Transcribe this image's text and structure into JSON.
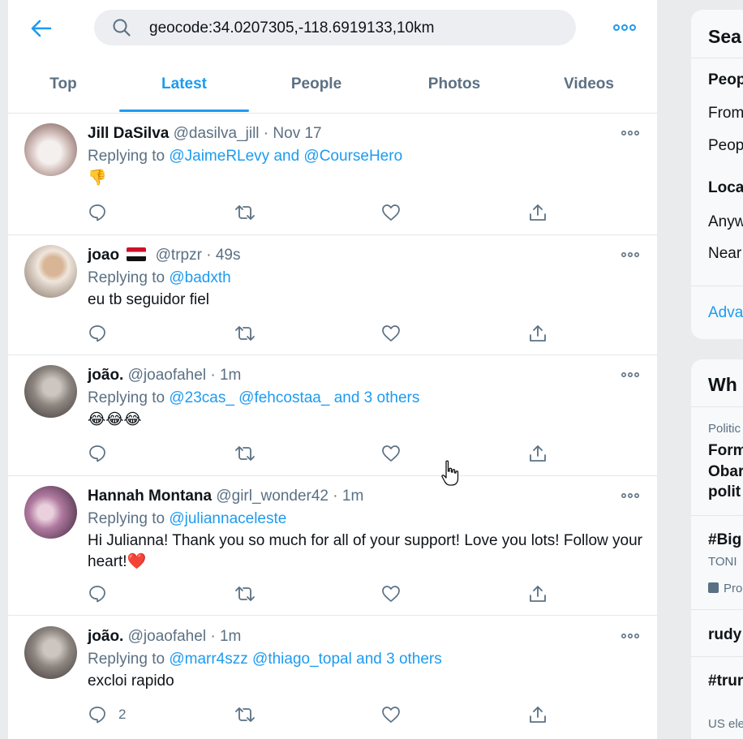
{
  "search": {
    "query": "geocode:34.0207305,-118.6919133,10km"
  },
  "tabs": {
    "top": "Top",
    "latest": "Latest",
    "people": "People",
    "photos": "Photos",
    "videos": "Videos",
    "active": "Latest"
  },
  "tweets": [
    {
      "name": "Jill DaSilva",
      "handle": "@dasilva_jill",
      "time": "Nov 17",
      "reply_prefix": "Replying to",
      "mentions": "@JaimeRLevy and @CourseHero",
      "body": "👎",
      "reply_count": ""
    },
    {
      "name": "joao",
      "handle": "@trpzr",
      "time": "49s",
      "reply_prefix": "Replying to",
      "mentions": "@badxth",
      "body": "eu tb seguidor fiel",
      "reply_count": ""
    },
    {
      "name": "joão.",
      "handle": "@joaofahel",
      "time": "1m",
      "reply_prefix": "Replying to",
      "mentions": "@23cas_ @fehcostaa_ and 3 others",
      "body": "😂😂😂",
      "reply_count": ""
    },
    {
      "name": "Hannah Montana",
      "handle": "@girl_wonder42",
      "time": "1m",
      "reply_prefix": "Replying to",
      "mentions": "@juliannaceleste",
      "body": "Hi Julianna! Thank you so much for all of your support! Love you lots! Follow your heart!❤️",
      "reply_count": ""
    },
    {
      "name": "joão.",
      "handle": "@joaofahel",
      "time": "1m",
      "reply_prefix": "Replying to",
      "mentions": "@marr4szz @thiago_topal and 3 others",
      "body": "excloi rapido",
      "reply_count": "2"
    }
  ],
  "sidebar": {
    "search_heading": "Sea",
    "people_heading": "Peop",
    "from_option": "From",
    "people_option": "Peop",
    "location_heading": "Loca",
    "anywhere_option": "Anyw",
    "near_option": "Near",
    "advanced_link": "Adva",
    "trends_heading": "Wh",
    "trend1_category": "Politic",
    "trend1_lines": [
      "Form",
      "Obar",
      "polit"
    ],
    "trend2_tag": "#Big",
    "trend2_sub": "TONI",
    "trend2_promo": "Pro",
    "trend3_tag": "rudy",
    "trend4_tag": "#trur",
    "trend4_sub": "US ele"
  },
  "colors": {
    "accent": "#1d9bf0",
    "secondary_text": "#5b7083",
    "primary_text": "#0f1419",
    "heart": "#e0245e"
  },
  "icons": {
    "back": "arrow-left-icon",
    "search": "magnifier-icon",
    "more": "more-dots-icon",
    "reply": "reply-icon",
    "retweet": "retweet-icon",
    "like": "heart-icon",
    "share": "share-icon"
  }
}
